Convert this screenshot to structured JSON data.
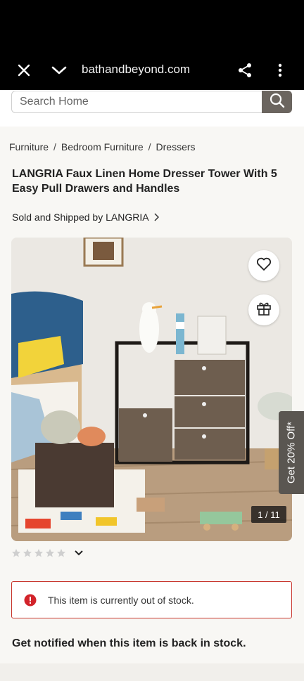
{
  "browser": {
    "url": "bathandbeyond.com",
    "close_icon": "close-icon",
    "dropdown_icon": "chevron-down-icon",
    "share_icon": "share-icon",
    "menu_icon": "more-vert-icon"
  },
  "search": {
    "placeholder": "Search Home",
    "button_icon": "search-icon"
  },
  "breadcrumb": [
    "Furniture",
    "Bedroom Furniture",
    "Dressers"
  ],
  "breadcrumb_separator": "/",
  "product": {
    "title": "LANGRIA Faux Linen Home Dresser Tower With 5 Easy Pull Drawers and Handles",
    "seller": "Sold and Shipped by LANGRIA",
    "image_counter": "1 / 11",
    "rating_stars": 0,
    "rating_max": 5
  },
  "promo": {
    "label": "Get 20% Off*"
  },
  "stock": {
    "alert": "This item is currently out of stock.",
    "notify_heading": "Get notified when this item is back in stock."
  },
  "colors": {
    "accent_dark": "#6b655f",
    "alert_border": "#c8352c",
    "alert_icon": "#d2232a"
  }
}
